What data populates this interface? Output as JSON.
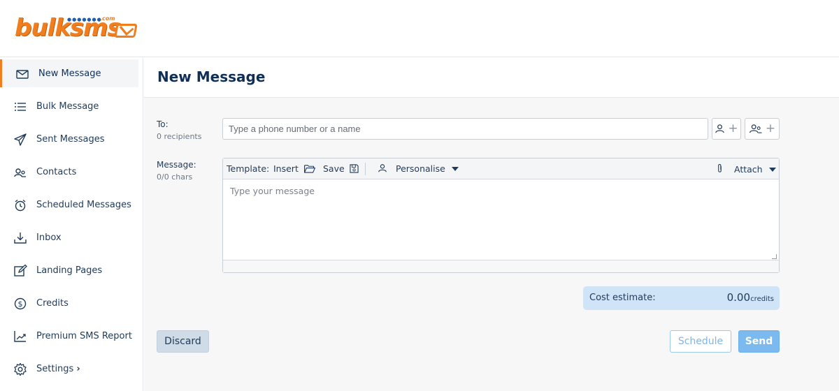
{
  "brand": {
    "logo_text": "bulksms",
    "logo_suffix": ".com",
    "accent_color": "#f07e1f",
    "primary_color": "#0f2f58"
  },
  "sidebar": {
    "items": [
      {
        "label": "New Message",
        "icon": "envelope-icon",
        "active": true
      },
      {
        "label": "Bulk Message",
        "icon": "list-icon"
      },
      {
        "label": "Sent Messages",
        "icon": "paper-plane-icon"
      },
      {
        "label": "Contacts",
        "icon": "contacts-icon"
      },
      {
        "label": "Scheduled Messages",
        "icon": "alarm-clock-icon"
      },
      {
        "label": "Inbox",
        "icon": "download-tray-icon"
      },
      {
        "label": "Landing Pages",
        "icon": "edit-icon"
      },
      {
        "label": "Credits",
        "icon": "dollar-circle-icon"
      },
      {
        "label": "Premium SMS Report",
        "icon": "trend-chart-icon"
      },
      {
        "label": "Settings",
        "icon": "gear-icon",
        "chevron": "›"
      }
    ]
  },
  "page": {
    "title": "New Message"
  },
  "form": {
    "to": {
      "label": "To:",
      "recipients": "0 recipients",
      "placeholder": "Type a phone number or a name",
      "value": ""
    },
    "message": {
      "label": "Message:",
      "chars": "0/0 chars",
      "placeholder": "Type your message",
      "value": "",
      "toolbar": {
        "template": "Template:",
        "insert": "Insert",
        "save": "Save",
        "personalise": "Personalise",
        "attach": "Attach"
      }
    },
    "cost": {
      "label": "Cost estimate:",
      "value": "0.00",
      "unit": "credits"
    }
  },
  "actions": {
    "discard": "Discard",
    "schedule": "Schedule",
    "send": "Send"
  }
}
